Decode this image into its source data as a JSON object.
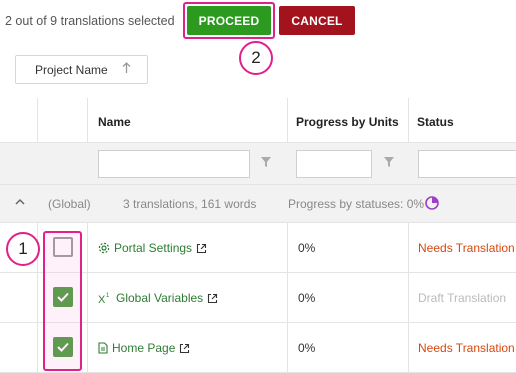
{
  "toolbar": {
    "selection_text": "2 out of 9 translations selected",
    "proceed_label": "PROCEED",
    "cancel_label": "CANCEL"
  },
  "callouts": [
    "1",
    "2"
  ],
  "sort": {
    "label": "Project Name"
  },
  "table": {
    "columns": [
      "Name",
      "Progress by Units",
      "Status"
    ],
    "group": {
      "label": "(Global)",
      "summary": "3 translations, 161 words",
      "progress_text": "Progress by statuses: 0%"
    },
    "rows": [
      {
        "name": "Portal Settings",
        "icon": "gear-icon",
        "checked": false,
        "progress": "0%",
        "status": "Needs Translation"
      },
      {
        "name": "Global Variables",
        "icon": "variable-icon",
        "checked": true,
        "progress": "0%",
        "status": "Draft Translation"
      },
      {
        "name": "Home Page",
        "icon": "page-icon",
        "checked": true,
        "progress": "0%",
        "status": "Needs Translation"
      }
    ]
  },
  "colors": {
    "proceed": "#2b9a1f",
    "cancel": "#a3131d",
    "highlight": "#e0218a",
    "link": "#2e7d32",
    "needs_translation": "#d9480f",
    "draft_translation": "#bbbbbb"
  }
}
